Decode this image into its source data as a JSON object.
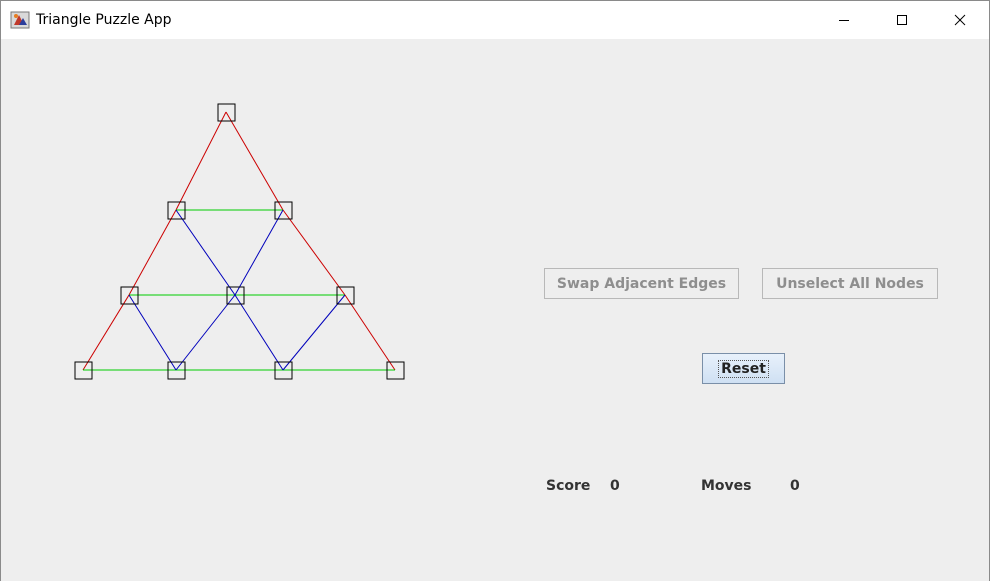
{
  "window": {
    "title": "Triangle Puzzle App",
    "icon": "java-app-icon"
  },
  "controls": {
    "minimize_icon": "minimize-icon",
    "maximize_icon": "maximize-icon",
    "close_icon": "close-icon"
  },
  "buttons": {
    "swap_label": "Swap Adjacent Edges",
    "unselect_label": "Unselect All Nodes",
    "reset_label": "Reset"
  },
  "stats": {
    "score_label": "Score",
    "score_value": "0",
    "moves_label": "Moves",
    "moves_value": "0"
  },
  "puzzle": {
    "node_ids": [
      "n0",
      "n1",
      "n2",
      "n3",
      "n4",
      "n5",
      "n6",
      "n7",
      "n8",
      "n9"
    ],
    "edges": [
      {
        "from": "n0",
        "to": "n1",
        "color": "#cc0000"
      },
      {
        "from": "n1",
        "to": "n3",
        "color": "#cc0000"
      },
      {
        "from": "n3",
        "to": "n6",
        "color": "#cc0000"
      },
      {
        "from": "n0",
        "to": "n2",
        "color": "#cc0000"
      },
      {
        "from": "n2",
        "to": "n5",
        "color": "#cc0000"
      },
      {
        "from": "n5",
        "to": "n9",
        "color": "#cc0000"
      },
      {
        "from": "n1",
        "to": "n2",
        "color": "#00cc00"
      },
      {
        "from": "n3",
        "to": "n4",
        "color": "#00cc00"
      },
      {
        "from": "n4",
        "to": "n5",
        "color": "#00cc00"
      },
      {
        "from": "n6",
        "to": "n7",
        "color": "#00cc00"
      },
      {
        "from": "n7",
        "to": "n8",
        "color": "#00cc00"
      },
      {
        "from": "n8",
        "to": "n9",
        "color": "#00cc00"
      },
      {
        "from": "n1",
        "to": "n4",
        "color": "#0000bb"
      },
      {
        "from": "n2",
        "to": "n4",
        "color": "#0000bb"
      },
      {
        "from": "n3",
        "to": "n7",
        "color": "#0000bb"
      },
      {
        "from": "n4",
        "to": "n7",
        "color": "#0000bb"
      },
      {
        "from": "n4",
        "to": "n8",
        "color": "#0000bb"
      },
      {
        "from": "n5",
        "to": "n8",
        "color": "#0000bb"
      }
    ]
  }
}
